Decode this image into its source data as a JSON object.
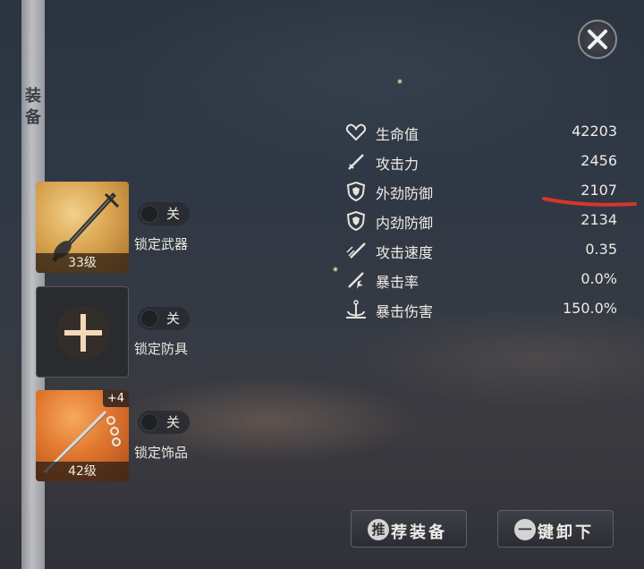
{
  "sidebar": {
    "label": "装\n备"
  },
  "slots": [
    {
      "level": "33级",
      "toggle": "关",
      "lock_label": "锁定武器",
      "badge": ""
    },
    {
      "level": "",
      "toggle": "关",
      "lock_label": "锁定防具",
      "badge": ""
    },
    {
      "level": "42级",
      "toggle": "关",
      "lock_label": "锁定饰品",
      "badge": "+4"
    }
  ],
  "stats": [
    {
      "label": "生命值",
      "value": "42203",
      "icon": "heart-icon"
    },
    {
      "label": "攻击力",
      "value": "2456",
      "icon": "sword-icon"
    },
    {
      "label": "外劲防御",
      "value": "2107",
      "icon": "shield-icon"
    },
    {
      "label": "内劲防御",
      "value": "2134",
      "icon": "shield-icon"
    },
    {
      "label": "攻击速度",
      "value": "0.35",
      "icon": "swift-sword-icon"
    },
    {
      "label": "暴击率",
      "value": "0.0%",
      "icon": "crit-icon"
    },
    {
      "label": "暴击伤害",
      "value": "150.0%",
      "icon": "anchor-icon"
    }
  ],
  "buttons": {
    "recommend": {
      "glyph": "推",
      "label": "荐装备"
    },
    "unequip": {
      "glyph": "一",
      "label": "键卸下"
    }
  },
  "colors": {
    "highlight_underline": "#d8352c"
  }
}
